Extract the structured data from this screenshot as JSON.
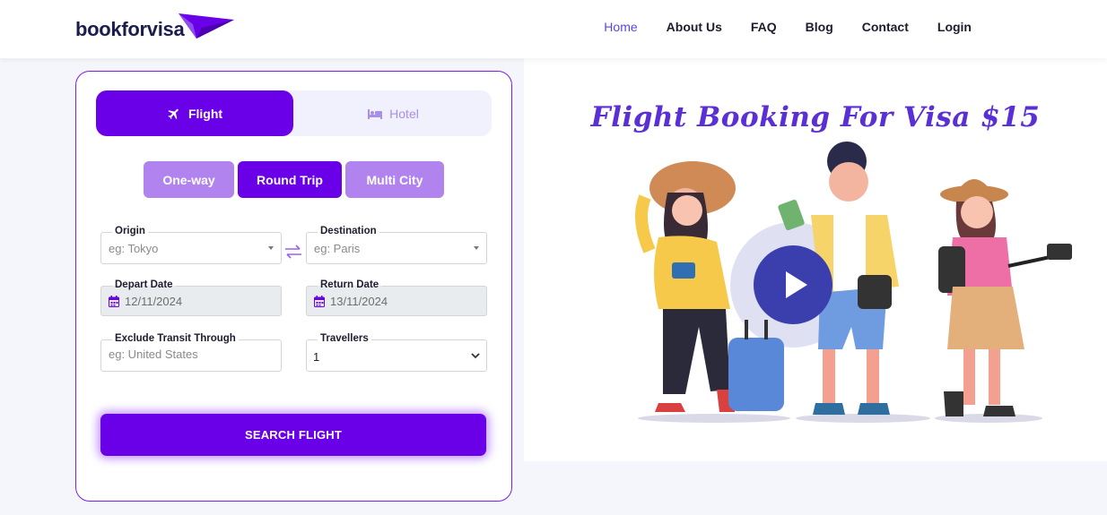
{
  "brand": {
    "name": "bookforvisa",
    "accent": "#6a00e8"
  },
  "nav": [
    {
      "label": "Home",
      "active": true
    },
    {
      "label": "About Us",
      "active": false
    },
    {
      "label": "FAQ",
      "active": false
    },
    {
      "label": "Blog",
      "active": false
    },
    {
      "label": "Contact",
      "active": false
    },
    {
      "label": "Login",
      "active": false
    }
  ],
  "booking": {
    "tabs": {
      "flight": "Flight",
      "hotel": "Hotel",
      "selected": "Flight"
    },
    "trip_types": {
      "one_way": "One-way",
      "round_trip": "Round Trip",
      "multi_city": "Multi City",
      "selected": "Round Trip"
    },
    "origin": {
      "label": "Origin",
      "placeholder": "eg: Tokyo"
    },
    "destination": {
      "label": "Destination",
      "placeholder": "eg: Paris"
    },
    "depart_date": {
      "label": "Depart Date",
      "value": "12/11/2024"
    },
    "return_date": {
      "label": "Return Date",
      "value": "13/11/2024"
    },
    "exclude_transit": {
      "label": "Exclude Transit Through",
      "placeholder": "eg: United States"
    },
    "travellers": {
      "label": "Travellers",
      "value": "1"
    },
    "search_button": "SEARCH FLIGHT"
  },
  "hero": {
    "title": "Flight Booking For Visa $15"
  }
}
